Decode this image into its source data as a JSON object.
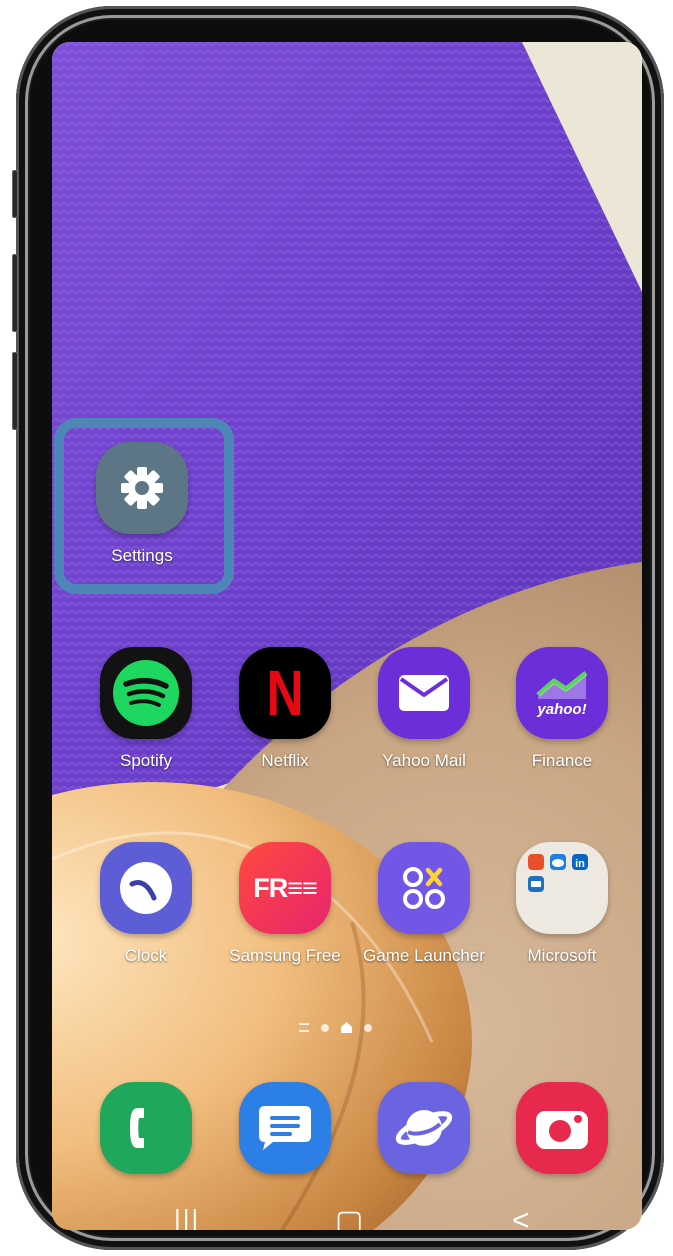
{
  "colors": {
    "highlight": "#4f86b8",
    "settings": "#5c7685",
    "spotify": "#1ed760",
    "netflix": "#e50914",
    "yahoo": "#6b2ed9",
    "clock": "#5d5ed6",
    "samsung_free": "#f0326a",
    "game_launcher": "#7257e6",
    "microsoft": "#ede8e0",
    "phone": "#1fa85b",
    "messages": "#2b7fe5",
    "internet": "#6a64e0",
    "camera": "#e8294e"
  },
  "home": {
    "settings": {
      "label": "Settings",
      "icon": "gear-icon"
    },
    "row1": [
      {
        "label": "Spotify",
        "icon": "spotify-icon"
      },
      {
        "label": "Netflix",
        "icon": "netflix-icon"
      },
      {
        "label": "Yahoo Mail",
        "icon": "mail-icon"
      },
      {
        "label": "Finance",
        "icon": "yahoo-finance-icon"
      }
    ],
    "row2": [
      {
        "label": "Clock",
        "icon": "clock-icon"
      },
      {
        "label": "Samsung Free",
        "icon": "samsung-free-icon"
      },
      {
        "label": "Game Launcher",
        "icon": "game-launcher-icon"
      },
      {
        "label": "Microsoft",
        "icon": "folder-icon"
      }
    ],
    "netflix_letter": "N",
    "yahoo_word": "yahoo!",
    "free_word": "FR≡≡"
  },
  "dock": [
    {
      "icon": "phone-icon"
    },
    {
      "icon": "messages-icon"
    },
    {
      "icon": "internet-icon"
    },
    {
      "icon": "camera-icon"
    }
  ],
  "page_indicator": {
    "pages": 3,
    "current": 2
  },
  "navbar": {
    "recents": "|||",
    "home": "▢",
    "back": "<"
  }
}
